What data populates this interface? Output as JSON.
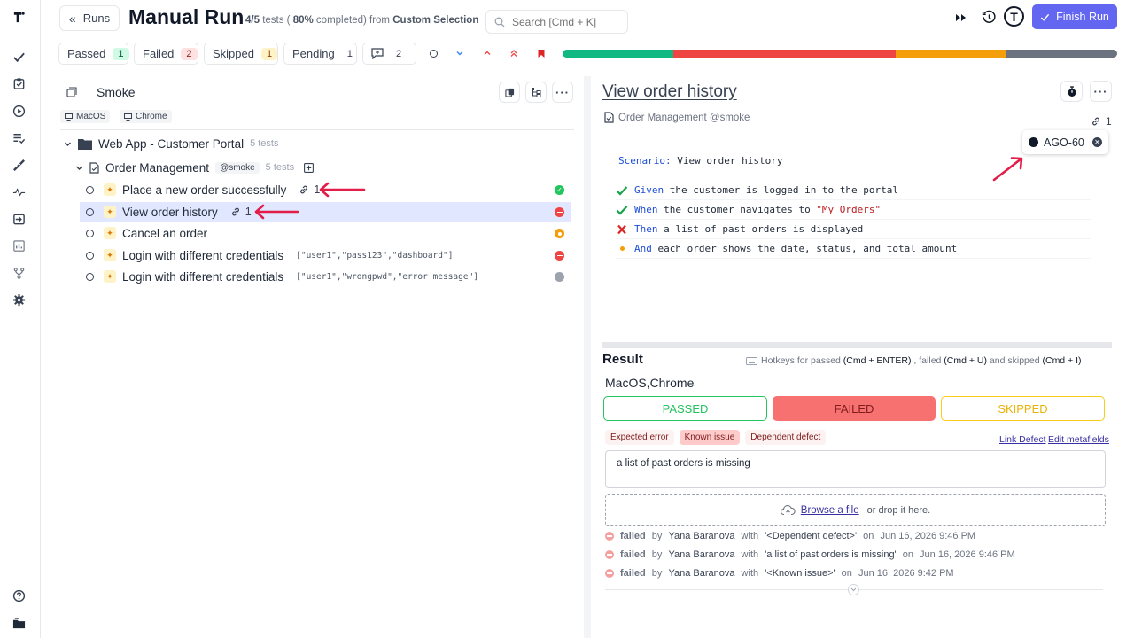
{
  "header": {
    "back_label": "Runs",
    "title": "Manual Run",
    "tests_count": "4/5",
    "progress_text_1": " tests ( ",
    "progress_pct": "80%",
    "progress_text_2": " completed) from ",
    "selection": "Custom Selection",
    "search_placeholder": "Search [Cmd + K]",
    "finish_label": "Finish Run",
    "avatar_initial": "T"
  },
  "filters": [
    {
      "label": "Passed",
      "count": "1"
    },
    {
      "label": "Failed",
      "count": "2"
    },
    {
      "label": "Skipped",
      "count": "1"
    },
    {
      "label": "Pending",
      "count": "1"
    },
    {
      "label": "",
      "count": "2"
    }
  ],
  "progress_bar": [
    {
      "fraction": 0.2,
      "color": "#10b981"
    },
    {
      "fraction": 0.4,
      "color": "#ef4444"
    },
    {
      "fraction": 0.2,
      "color": "#f59e0b"
    },
    {
      "fraction": 0.2,
      "color": "#6b7280"
    }
  ],
  "tree": {
    "plan_name": "Smoke",
    "envs": [
      "MacOS",
      "Chrome"
    ],
    "folder": {
      "name": "Web App - Customer Portal",
      "count": "5 tests"
    },
    "suite": {
      "name": "Order Management",
      "tag": "@smoke",
      "count": "5 tests"
    },
    "tests": [
      {
        "name": "Place a new order successfully",
        "links": "1",
        "params": "",
        "status": "passed"
      },
      {
        "name": "View order history",
        "links": "1",
        "params": "",
        "status": "failed"
      },
      {
        "name": "Cancel an order",
        "links": "",
        "params": "",
        "status": "skipped"
      },
      {
        "name": "Login with different credentials",
        "links": "",
        "params": "[\"user1\",\"pass123\",\"dashboard\"]",
        "status": "failed"
      },
      {
        "name": "Login with different credentials",
        "links": "",
        "params": "[\"user1\",\"wrongpwd\",\"error message\"]",
        "status": "pending"
      }
    ]
  },
  "detail": {
    "title": "View order history",
    "suite_ref": "Order Management @smoke",
    "links_count": "1",
    "issue": "AGO-60",
    "scenario_kw": "Scenario:",
    "scenario": " View order history",
    "steps": [
      {
        "status": "passed",
        "kw": "Given",
        "text": " the customer is logged in to the portal",
        "str": "",
        "tail": ""
      },
      {
        "status": "passed",
        "kw": "When",
        "text": " the customer navigates to ",
        "str": "\"My Orders\"",
        "tail": ""
      },
      {
        "status": "failed",
        "kw": "Then",
        "text": " a list of past orders is displayed",
        "str": "",
        "tail": ""
      },
      {
        "status": "skipped",
        "kw": "And",
        "text": " each order shows the date, status, and total amount",
        "str": "",
        "tail": ""
      }
    ]
  },
  "result": {
    "title": "Result",
    "hotkeys_prefix": "Hotkeys for passed ",
    "hk_passed": "(Cmd + ENTER)",
    "hk_mid1": " , failed ",
    "hk_failed": "(Cmd + U)",
    "hk_mid2": " and skipped ",
    "hk_skipped": "(Cmd + I)",
    "env": "MacOS,Chrome",
    "passed_label": "PASSED",
    "failed_label": "FAILED",
    "skipped_label": "SKIPPED",
    "tags": [
      "Expected error",
      "Known issue",
      "Dependent defect"
    ],
    "link_defect": "Link Defect",
    "edit_meta": "Edit metafields",
    "message": "a list of past orders is missing",
    "browse": "Browse a file",
    "drop": " or drop it here.",
    "history": [
      {
        "status": "failed",
        "by": " by ",
        "user": "Yana Baranova",
        "with": " with ",
        "msg": "'<Dependent defect>'",
        "on": " on ",
        "date": "Jun 16, 2026 9:46 PM"
      },
      {
        "status": "failed",
        "by": " by ",
        "user": "Yana Baranova",
        "with": " with ",
        "msg": "'a list of past orders is missing'",
        "on": " on ",
        "date": "Jun 16, 2026 9:46 PM"
      },
      {
        "status": "failed",
        "by": " by ",
        "user": "Yana Baranova",
        "with": " with ",
        "msg": "'<Known issue>'",
        "on": " on ",
        "date": "Jun 16, 2026 9:42 PM"
      }
    ]
  },
  "colors": {
    "accent": "#6366f1",
    "passed": "#22c55e",
    "failed": "#ef4444",
    "skipped": "#f59e0b",
    "pending": "#9ca3af",
    "annotation": "#e11d48"
  }
}
